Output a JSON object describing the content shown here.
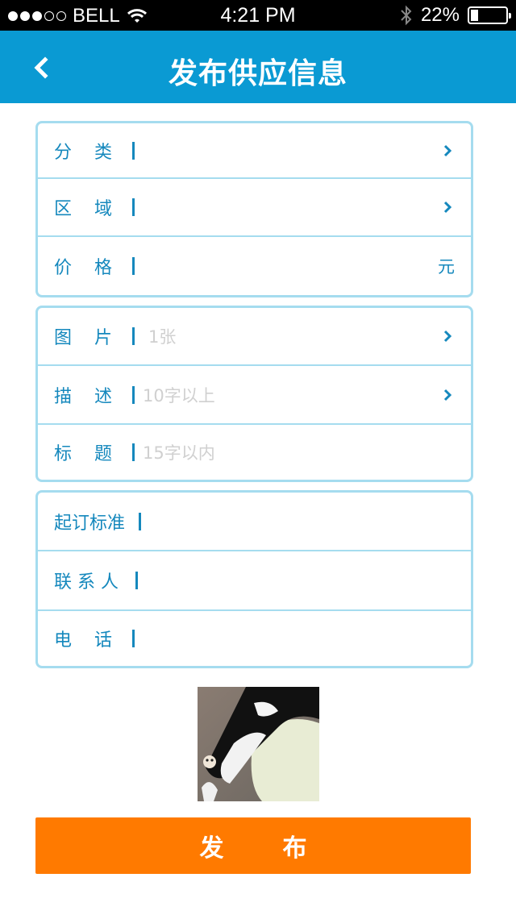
{
  "status_bar": {
    "carrier": "BELL",
    "time": "4:21 PM",
    "battery": "22%",
    "battery_level": 0.22,
    "signal_bars_filled": 3,
    "signal_bars_total": 5
  },
  "nav": {
    "title": "发布供应信息",
    "back_icon": "chevron-left-icon"
  },
  "group1": {
    "category_label": "分    类",
    "region_label": "区    域",
    "price_label": "价    格",
    "price_unit": "元"
  },
  "group2": {
    "image_label": "图    片",
    "image_placeholder": "1张",
    "desc_label": "描    述",
    "desc_placeholder": "10字以上",
    "title_label": "标    题",
    "title_placeholder": "15字以内"
  },
  "group3": {
    "min_order_label": "起订标准",
    "contact_label": "联 系 人",
    "phone_label": "电    话"
  },
  "publish_button": "发       布",
  "colors": {
    "nav_bg": "#0a9ad3",
    "accent": "#1588bd",
    "border": "#a5dcef",
    "button": "#ff7a00"
  }
}
